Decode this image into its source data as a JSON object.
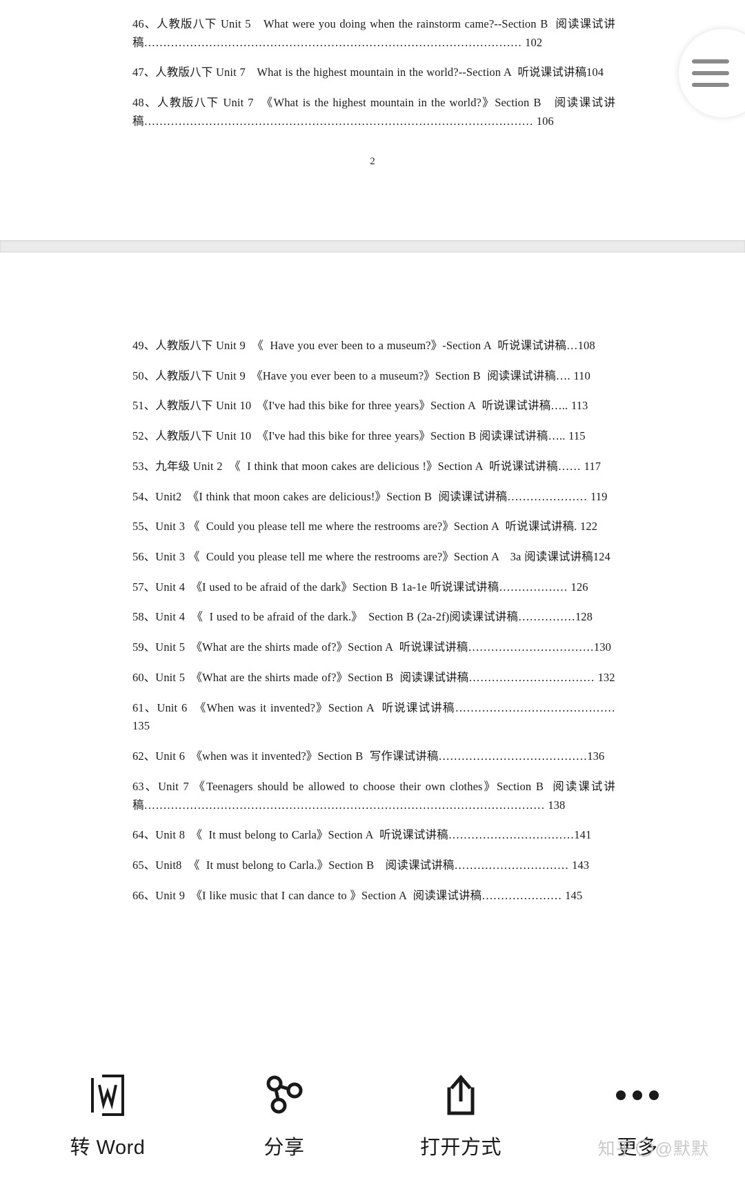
{
  "document": {
    "page_top": {
      "entries": [
        "46、人教版八下 Unit 5　What were you doing when the rainstorm came?--Section B  阅读课试讲稿……………………………………………………………………………………… 102",
        "47、人教版八下 Unit 7　What is the highest mountain in the world?--Section A  听说课试讲稿104",
        "48、人教版八下 Unit 7　《What is the highest mountain in the world?》Section B　阅读课试讲稿………………………………………………………………………………………… 106"
      ],
      "folio": "2"
    },
    "page_bottom": {
      "entries": [
        "49、人教版八下 Unit 9  《  Have you ever been to a museum?》-Section A  听说课试讲稿…108",
        "50、人教版八下 Unit 9　《Have you ever been to a museum?》Section B  阅读课试讲稿…. 110",
        "51、人教版八下 Unit 10　《I've had this bike for three years》Section A  听说课试讲稿….. 113",
        "52、人教版八下 Unit 10　《I've had this bike for three years》Section B 阅读课试讲稿….. 115",
        "53、九年级 Unit 2  《  I think that moon cakes are delicious !》Section A  听说课试讲稿…… 117",
        "54、Unit2　《I think that moon cakes are delicious!》Section B  阅读课试讲稿………………… 119",
        "55、Unit 3 《  Could you please tell me where the restrooms are?》Section A  听说课试讲稿. 122",
        "56、Unit 3 《  Could you please tell me where the restrooms are?》Section A　3a 阅读课试讲稿124",
        "57、Unit 4　《I used to be afraid of the dark》Section B 1a-1e 听说课试讲稿……………… 126",
        "58、Unit 4  《  I used to be afraid of the dark.》　Section B (2a-2f)阅读课试讲稿……………128",
        "59、Unit 5　《What are the shirts made of?》Section A  听说课试讲稿……………………………130",
        "60、Unit 5　《What are the shirts made of?》Section B  阅读课试讲稿…………………………… 132",
        "61、Unit 6　《When was it invented?》Section A  听说课试讲稿…………………………………… 135",
        "62、Unit 6　《when was it invented?》Section B  写作课试讲稿…………………………………136",
        "63、Unit 7 《Teenagers should be allowed to choose their own clothes》Section B  阅读课试讲稿…………………………………………………………………………………………… 138",
        "64、Unit 8　《  It must belong to Carla》Section A  听说课试讲稿……………………………141",
        "65、Unit8  《  It must belong to Carla.》Section B　阅读课试讲稿………………………… 143",
        "66、Unit 9　《I like music that I can dance to 》Section A  阅读课试讲稿………………… 145"
      ]
    }
  },
  "fab": {
    "name": "menu"
  },
  "toolbar": {
    "items": [
      {
        "label": "转 Word",
        "icon": "word-doc-icon"
      },
      {
        "label": "分享",
        "icon": "share-nodes-icon"
      },
      {
        "label": "打开方式",
        "icon": "open-with-upload-icon"
      },
      {
        "label": "更多",
        "icon": "ellipsis-icon"
      }
    ]
  },
  "watermark": {
    "prefix": "知乎",
    "suffix": "@默默"
  }
}
